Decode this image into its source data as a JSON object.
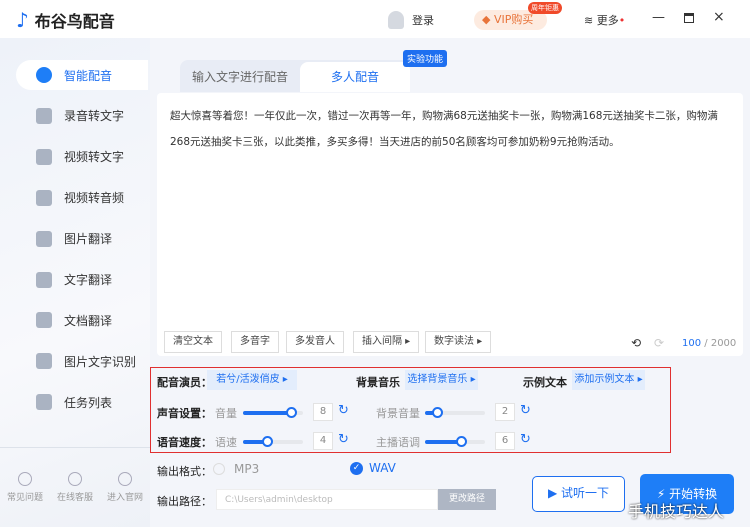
{
  "app": {
    "title": "布谷鸟配音",
    "login": "登录",
    "vip": "VIP购买",
    "vip_badge": "周年钜惠",
    "more": "更多"
  },
  "sidebar": {
    "items": [
      {
        "label": "智能配音"
      },
      {
        "label": "录音转文字"
      },
      {
        "label": "视频转文字"
      },
      {
        "label": "视频转音频"
      },
      {
        "label": "图片翻译"
      },
      {
        "label": "文字翻译"
      },
      {
        "label": "文档翻译"
      },
      {
        "label": "图片文字识别"
      },
      {
        "label": "任务列表"
      }
    ],
    "bottom": [
      {
        "label": "常见问题"
      },
      {
        "label": "在线客服"
      },
      {
        "label": "进入官网"
      }
    ]
  },
  "tabs": [
    {
      "label": "输入文字进行配音"
    },
    {
      "label": "多人配音"
    }
  ],
  "tab_badge": "实验功能",
  "text": "超大惊喜等着您！一年仅此一次，错过一次再等一年，购物满68元送抽奖卡一张，购物满168元送抽奖卡二张，购物满268元送抽奖卡三张，以此类推，多买多得！当天进店的前50名顾客均可参加奶粉9元抢购活动。",
  "toolbar": [
    "清空文本",
    "多音字",
    "多发音人",
    "插入间隔 ▸",
    "数字读法 ▸"
  ],
  "char_count": "100",
  "char_max": "/ 2000",
  "settings": {
    "actor_label": "配音演员：",
    "actor": "若兮/活泼俏皮  ▸",
    "bgm_label": "背景音乐",
    "bgm": "选择背景音乐 ▸",
    "sample_label": "示例文本",
    "sample": "添加示例文本 ▸",
    "sound_label": "声音设置：",
    "speed_label": "语音速度：",
    "volume": {
      "label": "音量",
      "value": 8,
      "max": 10
    },
    "bg_volume": {
      "label": "背景音量",
      "value": 2,
      "max": 10
    },
    "speed": {
      "label": "语速",
      "value": 4,
      "max": 10
    },
    "pitch": {
      "label": "主播语调",
      "value": 6,
      "max": 10
    }
  },
  "output": {
    "format_label": "输出格式：",
    "mp3": "MP3",
    "wav": "WAV",
    "selected": "WAV",
    "path_label": "输出路径：",
    "path": "C:\\Users\\admin\\desktop",
    "change": "更改路径"
  },
  "actions": {
    "preview": "试听一下",
    "start": "开始转换"
  },
  "watermark": "手机技巧达人"
}
